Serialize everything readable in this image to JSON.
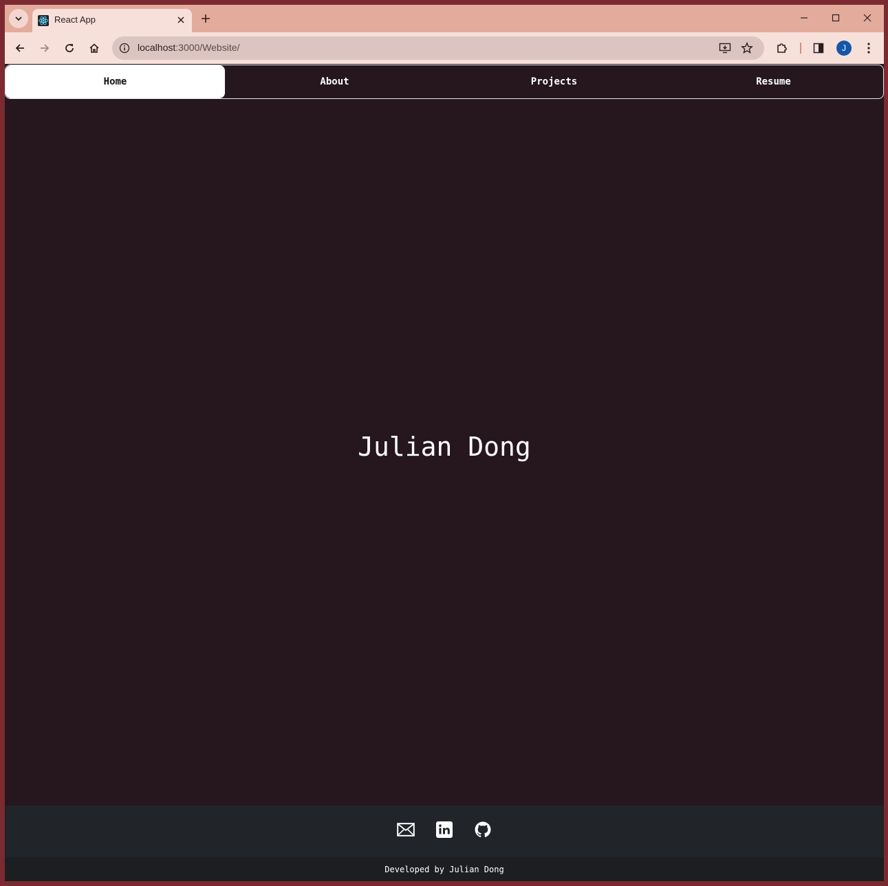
{
  "browser": {
    "tab": {
      "title": "React App",
      "favicon": "react-icon",
      "close_icon": "close-icon"
    },
    "new_tab_icon": "plus-icon",
    "tab_search_icon": "chevron-down-icon",
    "window_controls": [
      "minimize-icon",
      "maximize-icon",
      "close-icon"
    ],
    "toolbar": {
      "back_icon": "back-arrow-icon",
      "forward_icon": "forward-arrow-icon",
      "reload_icon": "reload-icon",
      "home_icon": "home-icon",
      "site_info_icon": "info-icon",
      "url_host": "localhost",
      "url_rest": ":3000/Website/",
      "install_icon": "install-app-icon",
      "bookmark_icon": "star-icon",
      "extensions_icon": "puzzle-icon",
      "side_panel_icon": "side-panel-icon",
      "profile_initial": "J",
      "menu_icon": "kebab-menu-icon"
    },
    "colors": {
      "frame": "#7a2a30",
      "tabstrip": "#e3ab9c",
      "toolbar": "#f7e0da",
      "omnibox": "#dcc5c0"
    }
  },
  "page": {
    "nav": {
      "items": [
        {
          "label": "Home",
          "active": true
        },
        {
          "label": "About",
          "active": false
        },
        {
          "label": "Projects",
          "active": false
        },
        {
          "label": "Resume",
          "active": false
        }
      ]
    },
    "hero": {
      "name": "Julian Dong"
    },
    "footer": {
      "icons": [
        "mail-icon",
        "linkedin-icon",
        "github-icon"
      ],
      "credit": "Developed by Julian Dong"
    },
    "colors": {
      "background": "#25171d",
      "footer": "#212428",
      "footer_credit": "#1c1e21",
      "text": "#ffffff"
    }
  }
}
